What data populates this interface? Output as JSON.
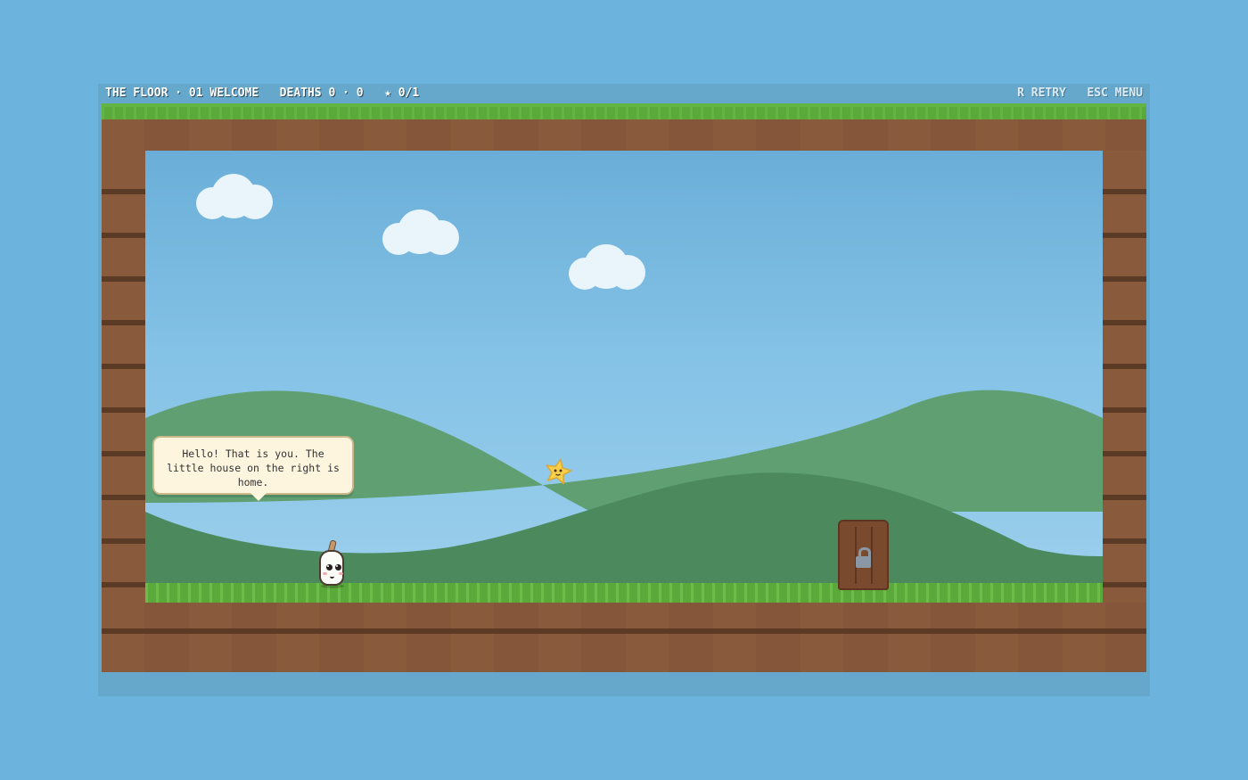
{
  "hud": {
    "level": "THE FLOOR · 01 WELCOME",
    "deaths": "DEATHS 0 · 0",
    "stars": "★ 0/1",
    "retry": "R RETRY",
    "menu": "ESC MENU"
  },
  "dialog": {
    "text": "Hello! That is you. The little house on the right is home."
  },
  "entities": {
    "player": "player-candle",
    "star": "collectible-star",
    "door": "locked-door"
  },
  "colors": {
    "sky": "#84c2e6",
    "grass": "#5aa93a",
    "dirt": "#8a5a3c",
    "hill_back": "#5f9f72",
    "hill_front": "#4c8a5e",
    "star": "#f7cf4a",
    "door": "#7a4a2e"
  }
}
